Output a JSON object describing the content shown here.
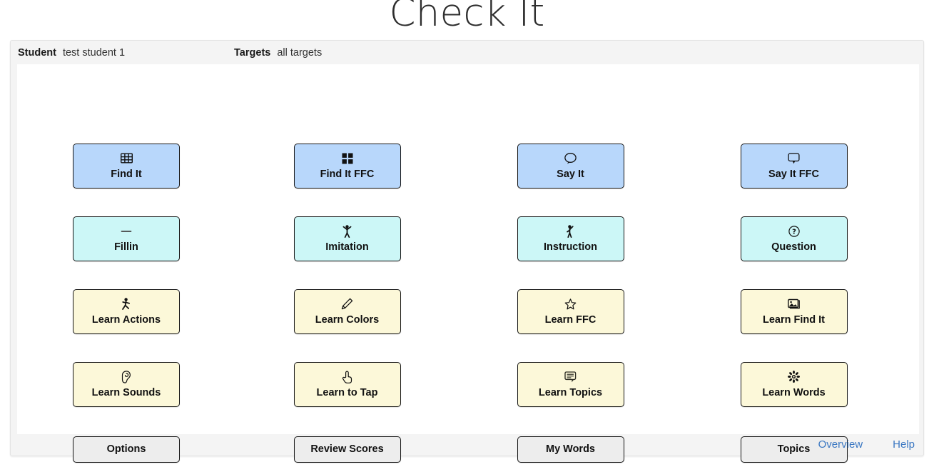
{
  "app": {
    "title": "Check It"
  },
  "header": {
    "student_label": "Student",
    "student_value": "test student 1",
    "targets_label": "Targets",
    "targets_value": "all targets"
  },
  "colors": {
    "blue": "#b8d7fb",
    "cyan": "#ccf7f7",
    "cream": "#fcf8d9",
    "gray": "#ededed",
    "link": "#3a77c2",
    "border": "#171717"
  },
  "grid": {
    "rows": [
      {
        "style": "blue",
        "buttons": [
          {
            "label": "Find It",
            "icon": "table-grid-icon"
          },
          {
            "label": "Find It FFC",
            "icon": "four-squares-icon"
          },
          {
            "label": "Say It",
            "icon": "round-speech-bubble-icon"
          },
          {
            "label": "Say It FFC",
            "icon": "square-speech-bubble-icon"
          }
        ]
      },
      {
        "style": "cyan",
        "buttons": [
          {
            "label": "Fillin",
            "icon": "dash-icon"
          },
          {
            "label": "Imitation",
            "icon": "person-arms-up-icon"
          },
          {
            "label": "Instruction",
            "icon": "person-one-arm-up-icon"
          },
          {
            "label": "Question",
            "icon": "question-circle-icon"
          }
        ]
      },
      {
        "style": "cream",
        "buttons": [
          {
            "label": "Learn Actions",
            "icon": "walking-person-icon"
          },
          {
            "label": "Learn Colors",
            "icon": "pencil-icon"
          },
          {
            "label": "Learn FFC",
            "icon": "star-outline-icon"
          },
          {
            "label": "Learn Find It",
            "icon": "picture-icon"
          }
        ]
      },
      {
        "style": "cream",
        "buttons": [
          {
            "label": "Learn Sounds",
            "icon": "ear-icon"
          },
          {
            "label": "Learn to Tap",
            "icon": "pointing-hand-icon"
          },
          {
            "label": "Learn Topics",
            "icon": "comment-lines-icon"
          },
          {
            "label": "Learn Words",
            "icon": "flower-rosette-icon"
          }
        ]
      },
      {
        "style": "gray",
        "buttons": [
          {
            "label": "Options",
            "icon": ""
          },
          {
            "label": "Review Scores",
            "icon": ""
          },
          {
            "label": "My Words",
            "icon": ""
          },
          {
            "label": "Topics",
            "icon": ""
          }
        ]
      }
    ]
  },
  "footer": {
    "overview_label": "Overview",
    "help_label": "Help"
  }
}
